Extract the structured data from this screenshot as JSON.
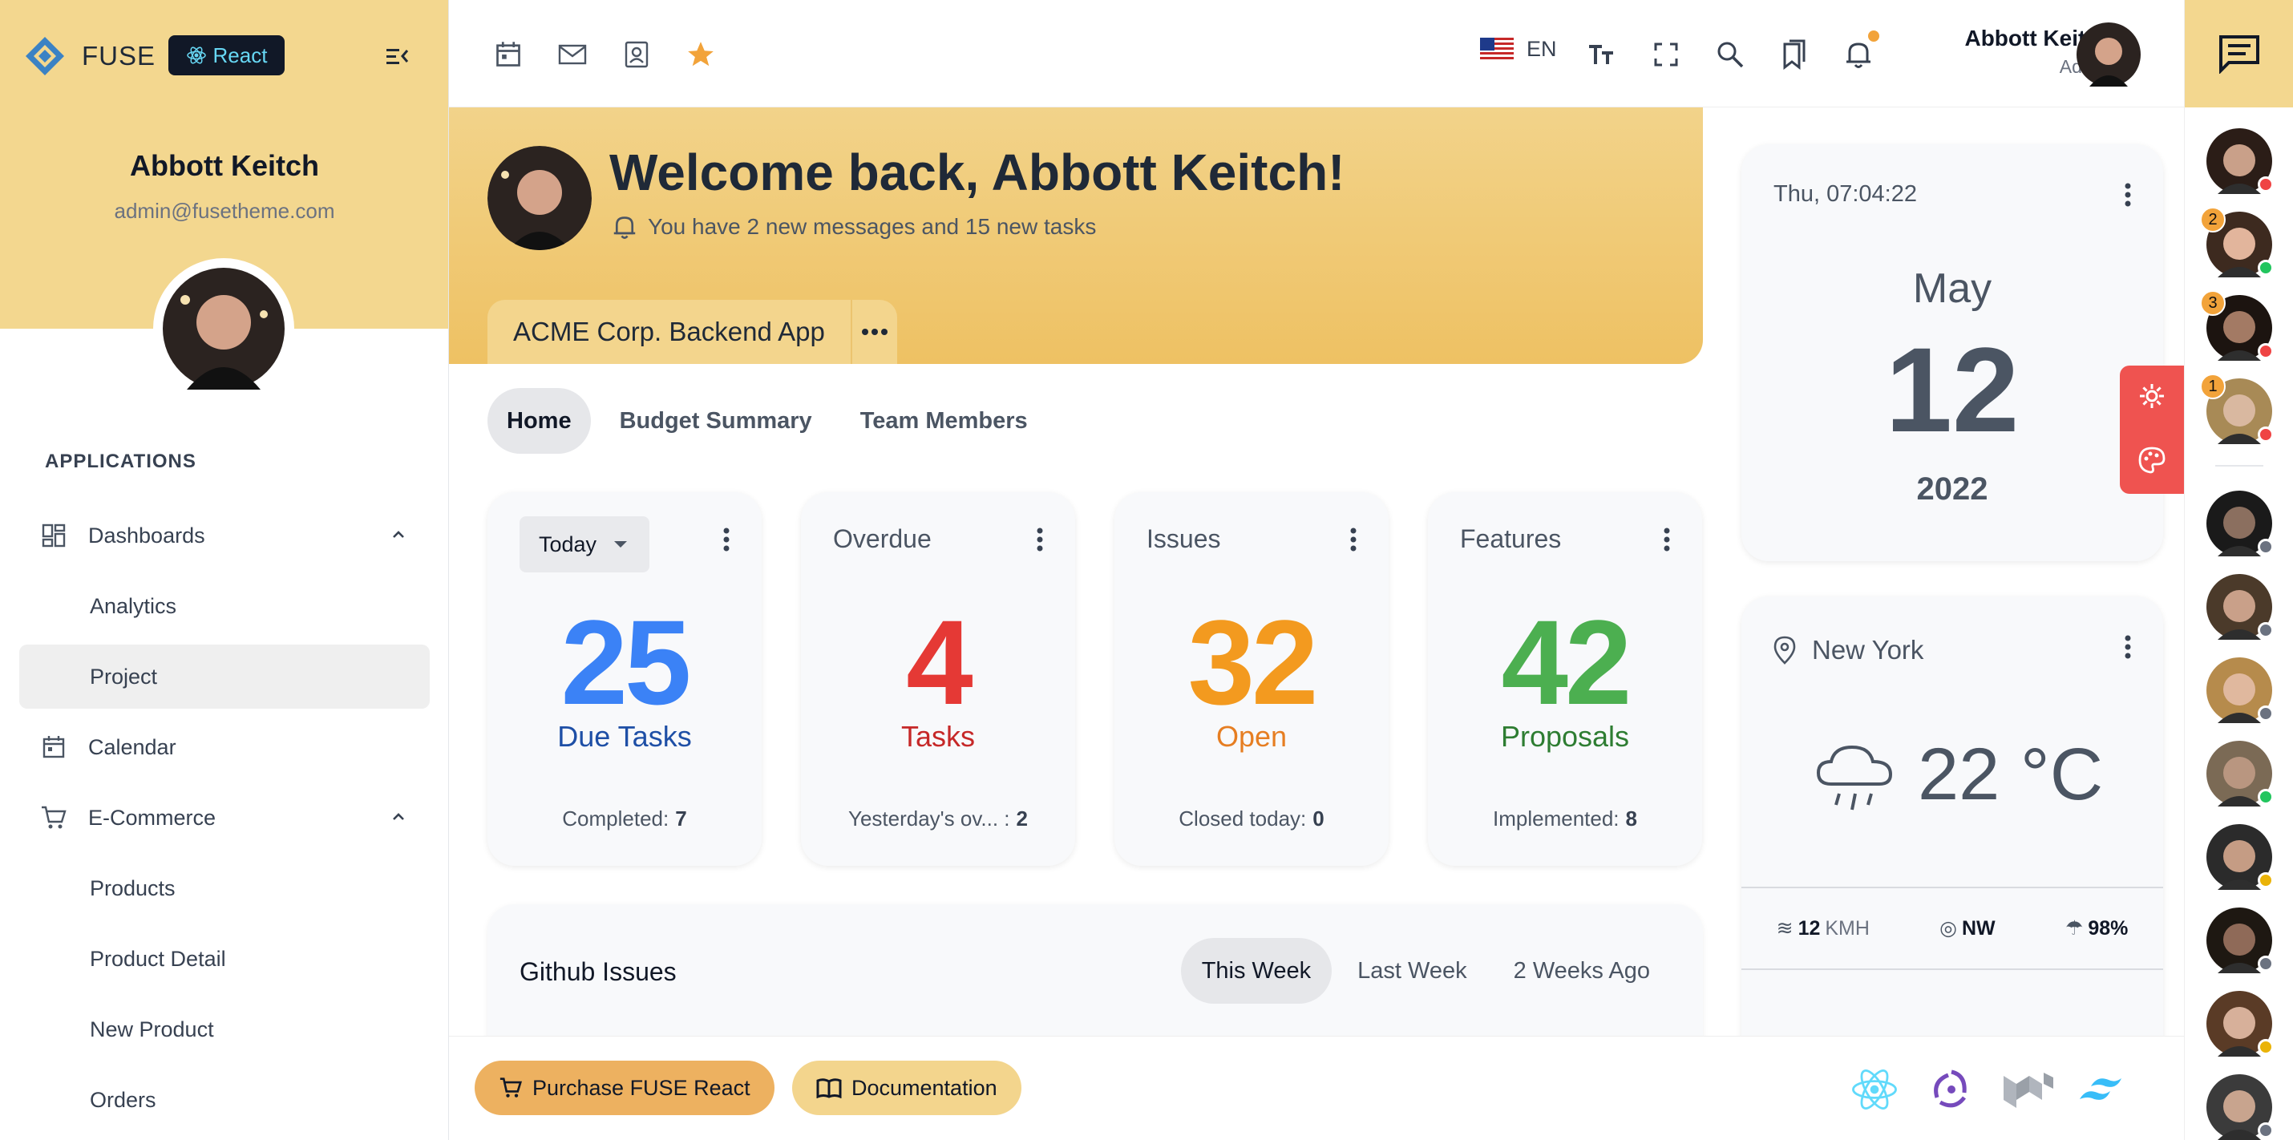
{
  "sidebar": {
    "brand": "FUSE",
    "badge": "React",
    "user_name": "Abbott Keitch",
    "user_email": "admin@fusetheme.com",
    "section_title": "APPLICATIONS",
    "items": [
      {
        "label": "Dashboards",
        "icon": "dashboard-icon"
      },
      {
        "label": "Analytics"
      },
      {
        "label": "Project"
      },
      {
        "label": "Calendar",
        "icon": "calendar-icon"
      },
      {
        "label": "E-Commerce",
        "icon": "cart-icon"
      },
      {
        "label": "Products"
      },
      {
        "label": "Product Detail"
      },
      {
        "label": "New Product"
      },
      {
        "label": "Orders"
      }
    ]
  },
  "topbar": {
    "language": "EN",
    "user_name": "Abbott Keitch",
    "user_role": "Admin",
    "shortcuts": [
      "calendar-icon",
      "mail-icon",
      "contacts-icon",
      "star-icon"
    ]
  },
  "hero": {
    "title": "Welcome back, Abbott Keitch!",
    "subtitle": "You have 2 new messages and 15 new tasks",
    "project": "ACME Corp. Backend App"
  },
  "tabs": [
    "Home",
    "Budget Summary",
    "Team Members"
  ],
  "stats": [
    {
      "head": "Today",
      "value": "25",
      "label": "Due Tasks",
      "foot_label": "Completed:",
      "foot_value": "7",
      "color": "#3b82f6",
      "label_color": "#1e4fa6"
    },
    {
      "head": "Overdue",
      "value": "4",
      "label": "Tasks",
      "foot_label": "Yesterday's ov... :",
      "foot_value": "2",
      "color": "#ef4444",
      "label_color": "#c62828"
    },
    {
      "head": "Issues",
      "value": "32",
      "label": "Open",
      "foot_label": "Closed today:",
      "foot_value": "0",
      "color": "#f59e0b",
      "label_color": "#e67e22"
    },
    {
      "head": "Features",
      "value": "42",
      "label": "Proposals",
      "foot_label": "Implemented:",
      "foot_value": "8",
      "color": "#4caf50",
      "label_color": "#2e7d32"
    }
  ],
  "github": {
    "title": "Github Issues",
    "tabs": [
      "This Week",
      "Last Week",
      "2 Weeks Ago"
    ]
  },
  "date_widget": {
    "time": "Thu, 07:04:22",
    "month": "May",
    "day": "12",
    "year": "2022"
  },
  "weather": {
    "location": "New York",
    "temperature": "22",
    "unit": "°C",
    "wind_speed": "12",
    "wind_unit": "KMH",
    "wind_dir": "NW",
    "humidity": "98%"
  },
  "bottombar": {
    "purchase": "Purchase FUSE React",
    "docs": "Documentation",
    "tech": [
      "react-icon",
      "redux-icon",
      "mui-icon",
      "tailwind-icon"
    ]
  },
  "contacts": [
    {
      "status": "#ef4444",
      "badge": ""
    },
    {
      "status": "#22c55e",
      "badge": "2"
    },
    {
      "status": "#ef4444",
      "badge": "3"
    },
    {
      "status": "#ef4444",
      "badge": "1"
    },
    {
      "status": "#6b7280",
      "badge": ""
    },
    {
      "status": "#6b7280",
      "badge": ""
    },
    {
      "status": "#6b7280",
      "badge": ""
    },
    {
      "status": "#22c55e",
      "badge": ""
    },
    {
      "status": "#eab308",
      "badge": ""
    },
    {
      "status": "#6b7280",
      "badge": ""
    },
    {
      "status": "#eab308",
      "badge": ""
    },
    {
      "status": "#6b7280",
      "badge": ""
    }
  ],
  "colors": {
    "accent": "#f3d78f",
    "hero": "#eec163",
    "settings": "#ef5350"
  }
}
